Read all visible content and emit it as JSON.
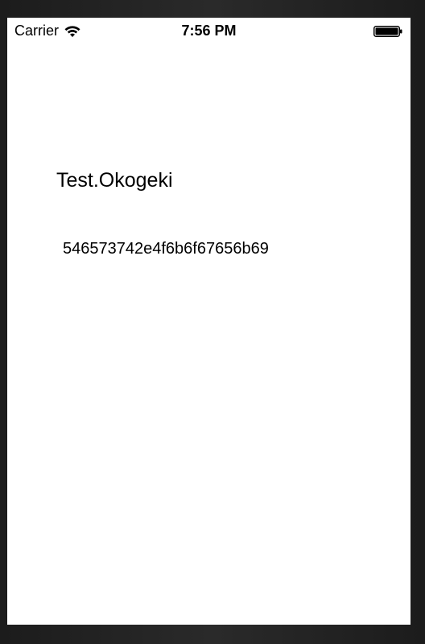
{
  "status_bar": {
    "carrier": "Carrier",
    "time": "7:56 PM",
    "wifi_icon": "wifi-icon",
    "battery_icon": "battery-icon"
  },
  "main": {
    "title": "Test.Okogeki",
    "hex_value": "546573742e4f6b6f67656b69"
  }
}
